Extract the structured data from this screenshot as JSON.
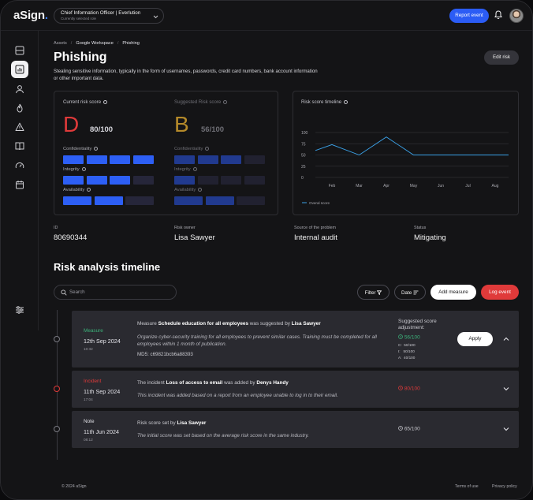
{
  "app": {
    "logo_text": "aSign",
    "logo_dot": ".",
    "role_title": "Chief Information Officer | Everlution",
    "role_subtitle": "Currently selected role",
    "report_event_label": "Report event",
    "accent_color": "#2b5cf5"
  },
  "sidebar": {
    "items": [
      {
        "icon": "layout-icon"
      },
      {
        "icon": "chart-icon",
        "active": true
      },
      {
        "icon": "user-icon"
      },
      {
        "icon": "flame-icon"
      },
      {
        "icon": "warning-icon"
      },
      {
        "icon": "book-icon"
      },
      {
        "icon": "gauge-icon"
      },
      {
        "icon": "calendar-icon"
      },
      {
        "icon": "sliders-icon"
      }
    ]
  },
  "breadcrumb": [
    "Assets",
    "Google Workspace",
    "Phishing"
  ],
  "page": {
    "title": "Phishing",
    "description": "Stealing sensitive information, typically in the form of usernames, passwords, credit card numbers, bank account information or other important data.",
    "edit_label": "Edit risk"
  },
  "current_score": {
    "label": "Current risk score",
    "grade": "D",
    "score": "80/100",
    "grade_color": "#e03a3a",
    "dimensions": [
      {
        "label": "Confidentiality",
        "filled": 4,
        "total": 4
      },
      {
        "label": "Integrity",
        "filled": 3,
        "total": 4
      },
      {
        "label": "Availability",
        "filled": 2,
        "total": 3
      }
    ]
  },
  "suggested_score": {
    "label": "Suggested Risk score",
    "grade": "B",
    "score": "56/100",
    "grade_color": "#b58a2a",
    "dimensions": [
      {
        "label": "Confidentiality",
        "filled": 3,
        "total": 4
      },
      {
        "label": "Integrity",
        "filled": 1,
        "total": 4
      },
      {
        "label": "Availability",
        "filled": 2,
        "total": 3
      }
    ]
  },
  "timeline_chart": {
    "label": "Risk score timeline",
    "legend": "Overal score"
  },
  "chart_data": {
    "type": "line",
    "title": "Risk score timeline",
    "categories": [
      "Feb",
      "Mar",
      "Apr",
      "May",
      "Jun",
      "Jul",
      "Aug"
    ],
    "y_ticks": [
      0,
      25,
      50,
      75,
      100
    ],
    "ylim": [
      0,
      100
    ],
    "grid": true,
    "legend_position": "bottom-left",
    "series": [
      {
        "name": "Overal score",
        "color": "#3aa0e6",
        "points": [
          {
            "x": "Jan",
            "y": 60
          },
          {
            "x": "Feb",
            "y": 73
          },
          {
            "x": "Mar",
            "y": 50
          },
          {
            "x": "Apr",
            "y": 90
          },
          {
            "x": "May",
            "y": 50
          },
          {
            "x": "Jun",
            "y": 50
          },
          {
            "x": "Jul",
            "y": 50
          },
          {
            "x": "Aug",
            "y": 50
          },
          {
            "x": "Sep",
            "y": 50
          }
        ]
      }
    ]
  },
  "meta": [
    {
      "label": "ID",
      "value": "80690344"
    },
    {
      "label": "Risk owner",
      "value": "Lisa Sawyer"
    },
    {
      "label": "Source of the problem",
      "value": "Internal audit"
    },
    {
      "label": "Status",
      "value": "Mitigating"
    }
  ],
  "analysis": {
    "title": "Risk analysis timeline",
    "search_placeholder": "Search",
    "filter_label": "Filter",
    "date_label": "Date",
    "add_measure_label": "Add measure",
    "log_event_label": "Log event"
  },
  "events": [
    {
      "type": "Measure",
      "type_color": "#3bb27a",
      "date": "12th Sep 2024",
      "time": "10:32",
      "head_pre": "Measure",
      "head_bold": "Schedule education for all employees",
      "head_mid": "was suggested by",
      "head_user": "Lisa Sawyer",
      "body": "Organize cyber-security training for all employees to prevent similar cases. Training must be completed for all employees within 1 month of publication.",
      "md5": "MD5: c69821bcb6a88393",
      "suggested_title": "Suggested score adjustment:",
      "suggested_score": "56/100",
      "suggested_dims": [
        {
          "k": "C:",
          "v": "50/100"
        },
        {
          "k": "I:",
          "v": "50/100"
        },
        {
          "k": "A:",
          "v": "40/100"
        }
      ],
      "apply_label": "Apply"
    },
    {
      "type": "Incident",
      "type_color": "#e03a3a",
      "date": "11th Sep 2024",
      "time": "17:04",
      "head_pre": "The incident",
      "head_bold": "Loss of access to email",
      "head_mid": "was added by",
      "head_user": "Denys Handy",
      "body": "This incident was added based on a report from an employee unable to log in to their email.",
      "score": "80/100"
    },
    {
      "type": "Note",
      "type_color": "#e4e4ea",
      "date": "11th Jun 2024",
      "time": "08:12",
      "head_pre": "Risk score set by",
      "head_bold": "Lisa Sawyer",
      "body": "The initial score was set based on the average risk score in the same industry.",
      "score": "65/100"
    }
  ],
  "footer": {
    "copyright": "© 2024 aSign",
    "terms": "Terms of use",
    "privacy": "Privacy policy"
  }
}
